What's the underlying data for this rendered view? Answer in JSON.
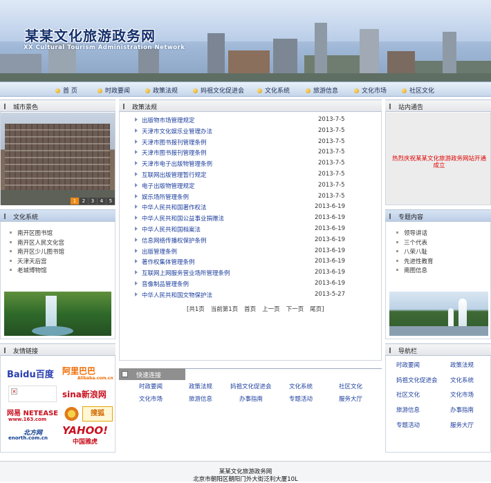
{
  "site": {
    "title": "某某文化旅游政务网",
    "subtitle": "XX Cultural Tourism Administration Network"
  },
  "nav": [
    "首  页",
    "时政要闻",
    "政策法规",
    "妈祖文化促进会",
    "文化系统",
    "旅游信息",
    "文化市场",
    "社区文化"
  ],
  "city_scenery": {
    "title": "城市景色",
    "pages": [
      "1",
      "2",
      "3",
      "4",
      "5"
    ],
    "active_page": "1"
  },
  "culture_system": {
    "title": "文化系统",
    "items": [
      "南开区图书馆",
      "南开区人民文化宫",
      "南开区少儿图书馆",
      "天津天后宫",
      "老城博物馆"
    ]
  },
  "friend_links": {
    "title": "友情链接",
    "logos": [
      "Baidu百度",
      "阿里巴巴",
      "Alibaba.com.cn",
      "sina新浪网",
      "网易 NETEASE",
      "www.163.com",
      "搜狐",
      "enorth.com.cn",
      "北方网",
      "YAHOO!",
      "中国雅虎"
    ]
  },
  "policy": {
    "title": "政策法规",
    "items": [
      {
        "title": "出版物市场管理规定",
        "date": "2013-7-5"
      },
      {
        "title": "天津市文化娱乐业管理办法",
        "date": "2013-7-5"
      },
      {
        "title": "天津市图书报刊管理条例",
        "date": "2013-7-5"
      },
      {
        "title": "天津市图书报刊管理条例",
        "date": "2013-7-5"
      },
      {
        "title": "天津市电子出版物管理条例",
        "date": "2013-7-5"
      },
      {
        "title": "互联网出版管理暂行规定",
        "date": "2013-7-5"
      },
      {
        "title": "电子出版物管理规定",
        "date": "2013-7-5"
      },
      {
        "title": "娱乐场所管理条例",
        "date": "2013-7-5"
      },
      {
        "title": "中华人民共和国著作权法",
        "date": "2013-6-19"
      },
      {
        "title": "中华人民共和国公益事业捐赠法",
        "date": "2013-6-19"
      },
      {
        "title": "中华人民共和国档案法",
        "date": "2013-6-19"
      },
      {
        "title": "信息网络传播权保护条例",
        "date": "2013-6-19"
      },
      {
        "title": "出版管理条例",
        "date": "2013-6-19"
      },
      {
        "title": "著作权集体管理条例",
        "date": "2013-6-19"
      },
      {
        "title": "互联网上网服务营业场所管理条例",
        "date": "2013-6-19"
      },
      {
        "title": "音像制品管理条例",
        "date": "2013-6-19"
      },
      {
        "title": "中华人民共和国文物保护法",
        "date": "2013-5-27"
      }
    ],
    "pager": [
      "[共1页",
      "当前第1页",
      "首页",
      "上一页",
      "下一页",
      "尾页]"
    ]
  },
  "quick_links": {
    "title": "快速连接",
    "items": [
      "时政要闻",
      "政策法规",
      "妈祖文化促进会",
      "文化系统",
      "社区文化",
      "文化市场",
      "旅游信息",
      "办事指南",
      "专题活动",
      "服务大厅"
    ]
  },
  "notice": {
    "title": "站内通告",
    "text": "热烈庆祝某某文化旅游政务网站开通成立"
  },
  "topics": {
    "title": "专题内容",
    "items": [
      "领导讲话",
      "三个代表",
      "八荣八耻",
      "先进性教育",
      "南图信息"
    ]
  },
  "navbar": {
    "title": "导航栏",
    "items": [
      "时政要闻",
      "政策法规",
      "妈祖文化促进会",
      "文化系统",
      "社区文化",
      "文化市场",
      "旅游信息",
      "办事指南",
      "专题活动",
      "服务大厅"
    ]
  },
  "footer": {
    "line1": "某某文化旅游政务网",
    "line2": "北京市朝阳区朝阳门外大街泛利大厦10L"
  }
}
